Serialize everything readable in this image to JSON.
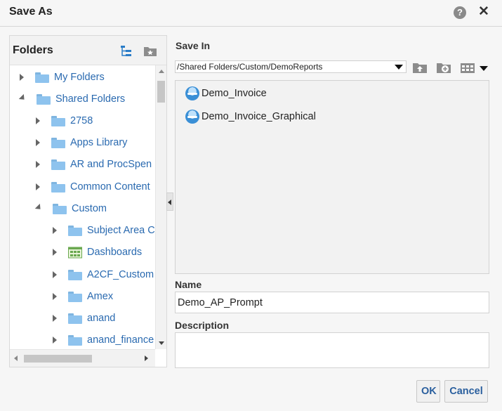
{
  "dialog": {
    "title": "Save As",
    "help_glyph": "?",
    "close_glyph": "✕"
  },
  "folders": {
    "title": "Folders",
    "items": [
      {
        "label": "My Folders",
        "expanded": false,
        "icon": "folder-icon"
      },
      {
        "label": "Shared Folders",
        "expanded": true,
        "icon": "folder-icon"
      },
      {
        "label": "2758",
        "expanded": false,
        "icon": "folder-icon"
      },
      {
        "label": "Apps Library",
        "expanded": false,
        "icon": "folder-icon"
      },
      {
        "label": "AR and ProcSpen",
        "expanded": false,
        "icon": "folder-icon"
      },
      {
        "label": "Common Content",
        "expanded": false,
        "icon": "folder-icon"
      },
      {
        "label": "Custom",
        "expanded": true,
        "icon": "folder-icon"
      },
      {
        "label": "Subject Area C",
        "expanded": false,
        "icon": "folder-icon"
      },
      {
        "label": "Dashboards",
        "expanded": false,
        "icon": "dashboard-folder-icon"
      },
      {
        "label": "A2CF_Custom",
        "expanded": false,
        "icon": "folder-icon"
      },
      {
        "label": "Amex",
        "expanded": false,
        "icon": "folder-icon"
      },
      {
        "label": "anand",
        "expanded": false,
        "icon": "folder-icon"
      },
      {
        "label": "anand_finance",
        "expanded": false,
        "icon": "folder-icon"
      }
    ]
  },
  "save_in": {
    "label": "Save In",
    "path": "/Shared Folders/Custom/DemoReports"
  },
  "files": [
    {
      "label": "Demo_Invoice"
    },
    {
      "label": "Demo_Invoice_Graphical"
    }
  ],
  "name_field": {
    "label": "Name",
    "value": "Demo_AP_Prompt"
  },
  "description_field": {
    "label": "Description",
    "value": ""
  },
  "buttons": {
    "ok": "OK",
    "cancel": "Cancel"
  },
  "colors": {
    "link": "#2a6ab0",
    "folder": "#8ec3ee",
    "button_text": "#2a5f9e"
  }
}
